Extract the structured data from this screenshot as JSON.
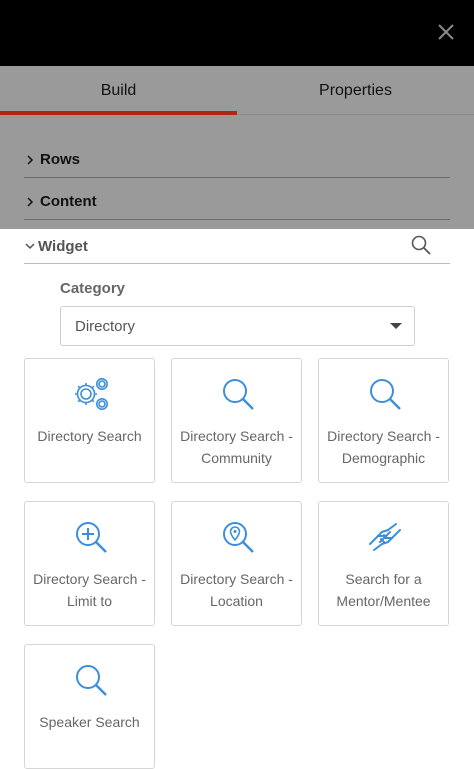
{
  "tabs": [
    {
      "label": "Build",
      "active": true
    },
    {
      "label": "Properties",
      "active": false
    }
  ],
  "sections": [
    {
      "label": "Rows",
      "expanded": false
    },
    {
      "label": "Content",
      "expanded": false
    }
  ],
  "widget": {
    "label": "Widget",
    "expanded": true,
    "category_label": "Category",
    "category_value": "Directory"
  },
  "tiles": [
    {
      "label": "Directory Search",
      "icon": "gears-icon"
    },
    {
      "label": "Directory Search - Community",
      "icon": "search-icon"
    },
    {
      "label": "Directory Search - Demographic",
      "icon": "search-icon"
    },
    {
      "label": "Directory Search - Limit to",
      "icon": "zoom-in-icon"
    },
    {
      "label": "Directory Search - Location",
      "icon": "location-search-icon"
    },
    {
      "label": "Search for a Mentor/Mentee",
      "icon": "handshake-icon"
    },
    {
      "label": "Speaker Search",
      "icon": "search-icon"
    }
  ],
  "colors": {
    "accent": "#b42318",
    "icon": "#3b8fd9",
    "overlay": "#9a9a9a"
  }
}
